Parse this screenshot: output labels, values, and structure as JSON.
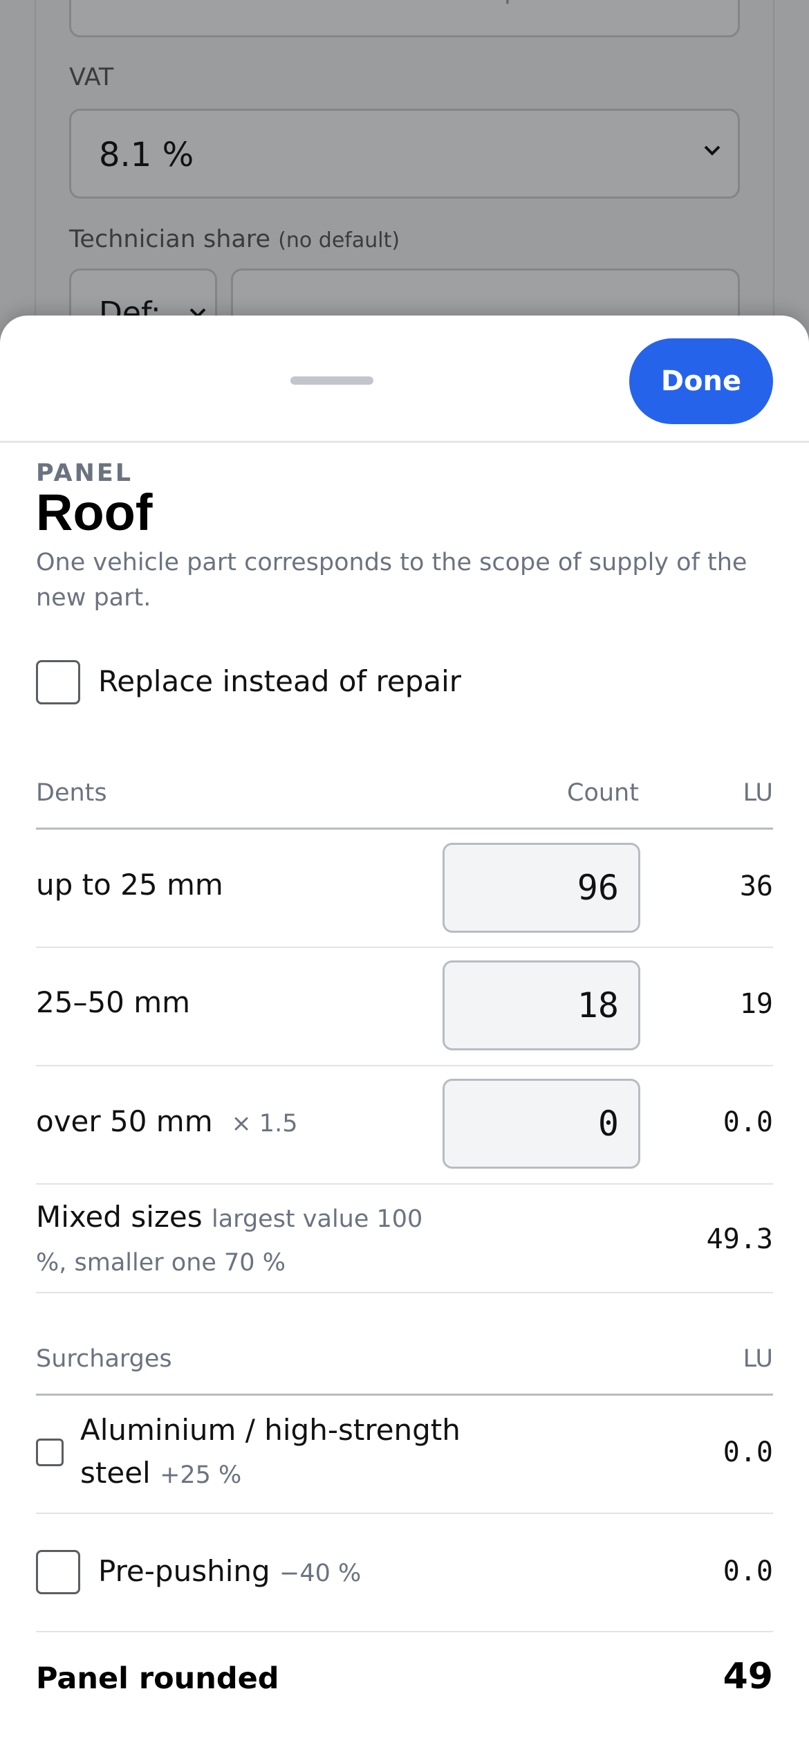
{
  "background_form": {
    "optional_placeholder": "optional",
    "vat_label": "VAT",
    "vat_value": "8.1 %",
    "technician_label": "Technician share",
    "technician_hint": "(no default)",
    "technician_select_value": "Def:"
  },
  "sheet": {
    "done_label": "Done",
    "eyebrow": "PANEL",
    "title": "Roof",
    "subtitle": "One vehicle part corresponds to the scope of supply of the new part.",
    "replace_label": "Replace instead of repair",
    "replace_checked": false
  },
  "dents": {
    "header": "Dents",
    "count_header": "Count",
    "lu_header": "LU",
    "rows": [
      {
        "label": "up to 25 mm",
        "modifier": "",
        "count": "96",
        "lu": "36"
      },
      {
        "label": "25–50 mm",
        "modifier": "",
        "count": "18",
        "lu": "19"
      },
      {
        "label": "over 50 mm",
        "modifier": "× 1.5",
        "count": "0",
        "lu": "0.0"
      }
    ],
    "mixed": {
      "label": "Mixed sizes",
      "note": "largest value 100 %, smaller one 70 %",
      "lu": "49.3"
    }
  },
  "surcharges": {
    "header": "Surcharges",
    "lu_header": "LU",
    "items": [
      {
        "label": "Aluminium / high-strength steel",
        "modifier": "+25 %",
        "lu": "0.0",
        "checked": false
      },
      {
        "label": "Pre-pushing",
        "modifier": "−40 %",
        "lu": "0.0",
        "checked": false
      }
    ]
  },
  "total": {
    "label": "Panel rounded",
    "value": "49"
  },
  "colors": {
    "accent": "#2563eb",
    "muted_text": "#6b7280",
    "backdrop": "#9b9c9e"
  }
}
